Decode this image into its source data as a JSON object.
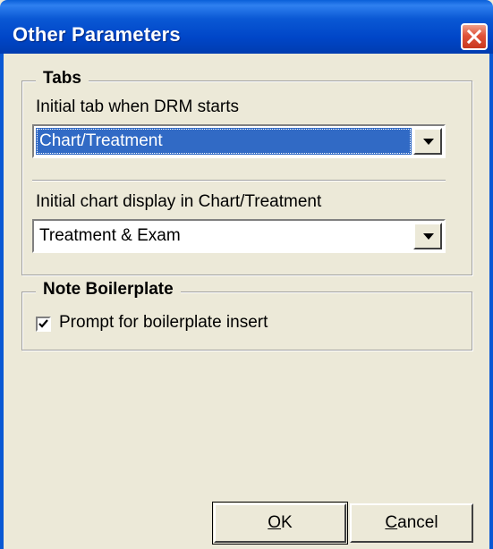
{
  "window": {
    "title": "Other Parameters"
  },
  "tabs_group": {
    "legend": "Tabs",
    "initial_tab_label": "Initial tab when DRM starts",
    "initial_tab_value": "Chart/Treatment",
    "initial_chart_label": "Initial chart display in Chart/Treatment",
    "initial_chart_value": "Treatment & Exam"
  },
  "boilerplate_group": {
    "legend": "Note Boilerplate",
    "prompt_label": "Prompt for boilerplate insert",
    "prompt_checked": true
  },
  "buttons": {
    "ok_mnemonic": "O",
    "ok_rest": "K",
    "cancel_mnemonic": "C",
    "cancel_rest": "ancel"
  },
  "colors": {
    "titlebar": "#0a58d4",
    "selection": "#316ac5",
    "dialog_bg": "#ece9d8"
  },
  "icons": {
    "close": "close-icon",
    "dropdown": "chevron-down-icon",
    "check": "checkmark-icon"
  }
}
